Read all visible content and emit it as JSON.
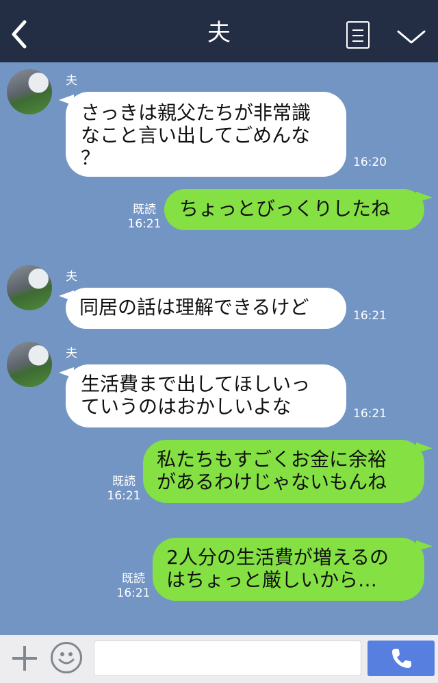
{
  "header": {
    "title": "夫"
  },
  "messages": [
    {
      "side": "left",
      "sender": "夫",
      "text": "さっきは親父たちが非常識\nなこと言い出してごめんな\n？",
      "time": "16:20"
    },
    {
      "side": "right",
      "read": "既読",
      "text": "ちょっとびっくりしたね",
      "time": "16:21"
    },
    {
      "side": "left",
      "sender": "夫",
      "text": "同居の話は理解できるけど",
      "time": "16:21"
    },
    {
      "side": "left",
      "sender": "夫",
      "text": "生活費まで出してほしいっ\nていうのはおかしいよな",
      "time": "16:21"
    },
    {
      "side": "right",
      "read": "既読",
      "text": "私たちもすごくお金に余裕\nがあるわけじゃないもんね",
      "time": "16:21"
    },
    {
      "side": "right",
      "read": "既読",
      "text": "2人分の生活費が増えるの\nはちょっと厳しいから…",
      "time": "16:21"
    }
  ],
  "input": {
    "placeholder": ""
  },
  "colors": {
    "header": "#232d44",
    "chat_bg": "#7395c4",
    "own_bubble": "#84e043",
    "other_bubble": "#ffffff",
    "send": "#567fe0"
  },
  "icons": {
    "back": "chevron-left-icon",
    "menu": "menu-list-icon",
    "collapse": "chevron-down-icon",
    "add": "plus-icon",
    "sticker": "smiley-icon",
    "call": "phone-icon"
  }
}
